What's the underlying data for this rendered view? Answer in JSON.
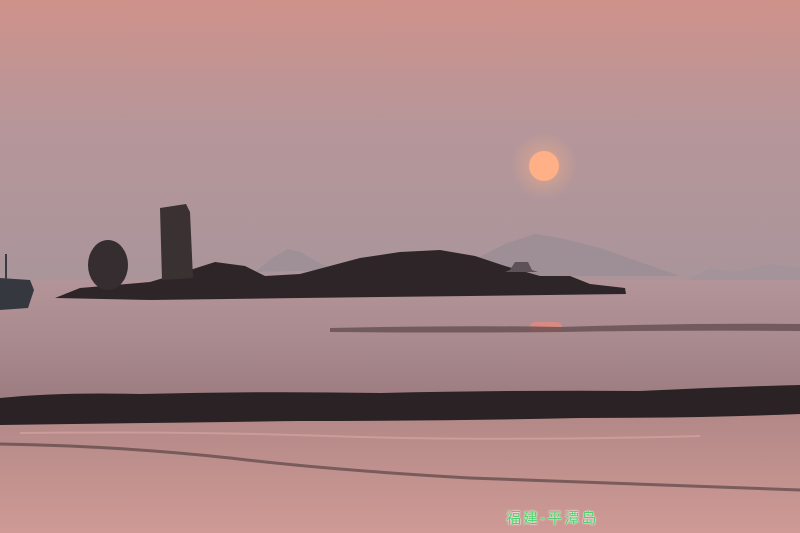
{
  "caption": {
    "text": "福建-平潭岛"
  },
  "colors": {
    "sky_top": "#d0948d",
    "sky_mid": "#b89596",
    "sky_horizon": "#a89499",
    "sun": "#ffb388",
    "sea": "#a8878b",
    "rocks": "#2b2426",
    "beach": "#c89692",
    "caption": "#4fd06a"
  }
}
